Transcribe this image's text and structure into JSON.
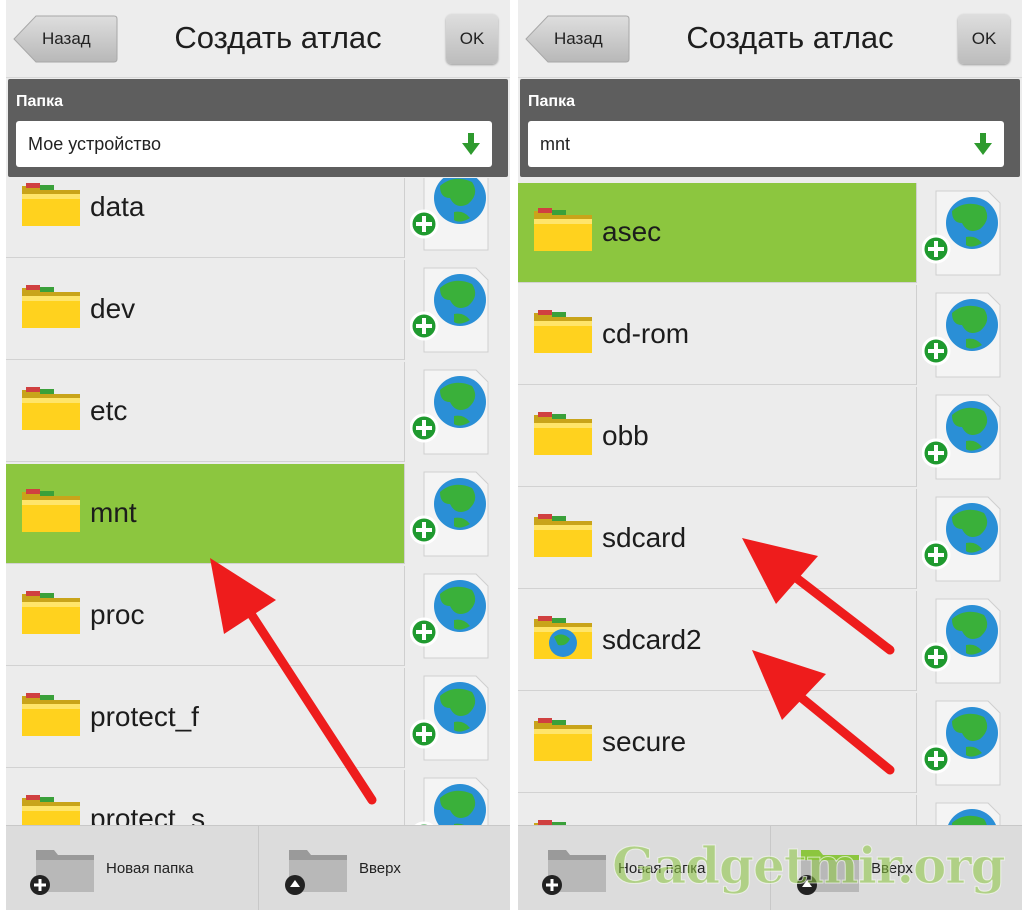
{
  "colors": {
    "selected": "#8cc63f",
    "arrow": "#ee1c1c",
    "folder": "#ffd21e",
    "globe": "#2a8fd6"
  },
  "panels": [
    {
      "header": {
        "back_label": "Назад",
        "title": "Создать атлас",
        "ok_label": "OK"
      },
      "folder": {
        "label": "Папка",
        "value": "Мое устройство"
      },
      "items": [
        {
          "name": "data",
          "icon": "folder-icon"
        },
        {
          "name": "dev",
          "icon": "folder-icon"
        },
        {
          "name": "etc",
          "icon": "folder-icon"
        },
        {
          "name": "mnt",
          "icon": "folder-icon",
          "selected": true
        },
        {
          "name": "proc",
          "icon": "folder-icon"
        },
        {
          "name": "protect_f",
          "icon": "folder-icon"
        },
        {
          "name": "protect_s",
          "icon": "folder-icon"
        }
      ],
      "bottom": {
        "new_folder_label": "Новая папка",
        "up_label": "Вверх"
      }
    },
    {
      "header": {
        "back_label": "Назад",
        "title": "Создать атлас",
        "ok_label": "OK"
      },
      "folder": {
        "label": "Папка",
        "value": "mnt"
      },
      "items": [
        {
          "name": "asec",
          "icon": "folder-icon",
          "selected": true
        },
        {
          "name": "cd-rom",
          "icon": "folder-icon"
        },
        {
          "name": "obb",
          "icon": "folder-icon"
        },
        {
          "name": "sdcard",
          "icon": "folder-icon"
        },
        {
          "name": "sdcard2",
          "icon": "globe-folder-icon"
        },
        {
          "name": "secure",
          "icon": "folder-icon"
        },
        {
          "name": "",
          "icon": "folder-icon"
        }
      ],
      "bottom": {
        "new_folder_label": "Новая папка",
        "up_label": "Вверх"
      }
    }
  ],
  "watermark": "Gadgetmir.org"
}
